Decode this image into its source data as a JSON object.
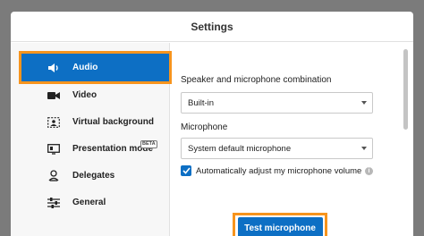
{
  "dialog": {
    "title": "Settings"
  },
  "sidebar": {
    "items": [
      {
        "label": "Audio",
        "icon": "speaker-icon",
        "active": true
      },
      {
        "label": "Video",
        "icon": "video-camera-icon"
      },
      {
        "label": "Virtual background",
        "icon": "virtual-background-icon"
      },
      {
        "label": "Presentation mode",
        "icon": "presentation-icon",
        "badge": "BETA"
      },
      {
        "label": "Delegates",
        "icon": "delegates-icon"
      },
      {
        "label": "General",
        "icon": "sliders-icon"
      }
    ]
  },
  "audio": {
    "speaker_mic_label": "Speaker and microphone combination",
    "speaker_mic_value": "Built-in",
    "microphone_label": "Microphone",
    "microphone_value": "System default microphone",
    "auto_adjust_label": "Automatically adjust my microphone volume",
    "auto_adjust_checked": true,
    "test_button": "Test microphone"
  },
  "colors": {
    "accent": "#0d6fc4",
    "highlight": "#f7941d"
  }
}
